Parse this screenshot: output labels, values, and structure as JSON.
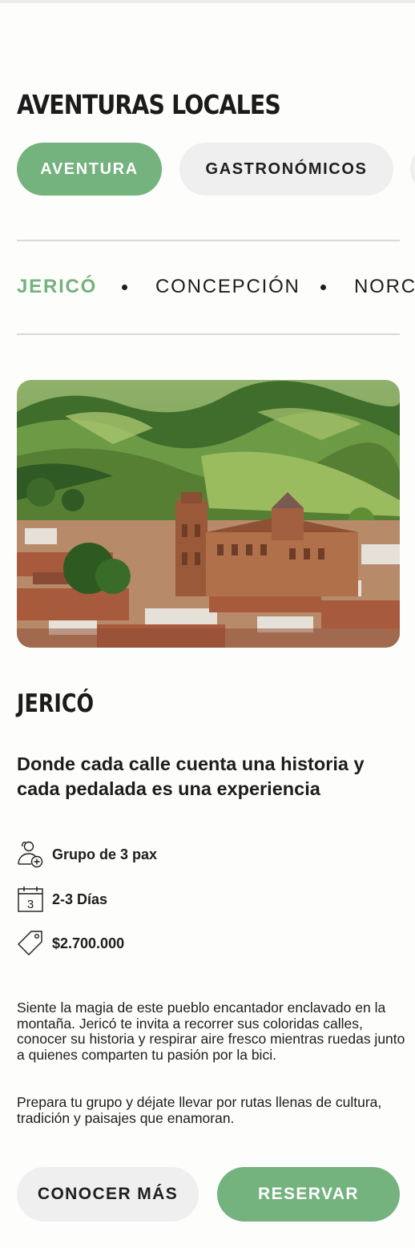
{
  "header": {
    "title": "AVENTURAS LOCALES"
  },
  "tabs": [
    {
      "label": "AVENTURA",
      "active": true
    },
    {
      "label": "GASTRONÓMICOS",
      "active": false
    }
  ],
  "locations": [
    {
      "label": "JERICÓ",
      "active": true
    },
    {
      "label": "CONCEPCIÓN",
      "active": false
    },
    {
      "label": "NORCASIA",
      "active": false
    }
  ],
  "tour": {
    "image": "town-photo",
    "name": "JERICÓ",
    "tagline": "Donde cada calle cuenta una historia y cada pedalada es una experiencia",
    "features": [
      {
        "icon": "group-add-icon",
        "text": "Grupo de 3 pax"
      },
      {
        "icon": "calendar-icon",
        "icon_number": "3",
        "text": "2-3 Días"
      },
      {
        "icon": "price-tag-icon",
        "text": "$2.700.000"
      }
    ],
    "description": [
      "Siente la magia de este pueblo encantador enclavado en la montaña. Jericó te invita a recorrer sus coloridas calles, conocer su historia y respirar aire fresco mientras ruedas junto a quienes comparten tu pasión por la bici.",
      "Prepara tu grupo y déjate llevar por rutas llenas de cultura, tradición y paisajes que enamoran."
    ]
  },
  "actions": {
    "more_label": "CONOCER MÁS",
    "book_label": "RESERVAR"
  },
  "colors": {
    "accent": "#74b27e",
    "chip_bg": "#efefef",
    "background": "#fdfdfb",
    "text": "#1d1d1d"
  }
}
